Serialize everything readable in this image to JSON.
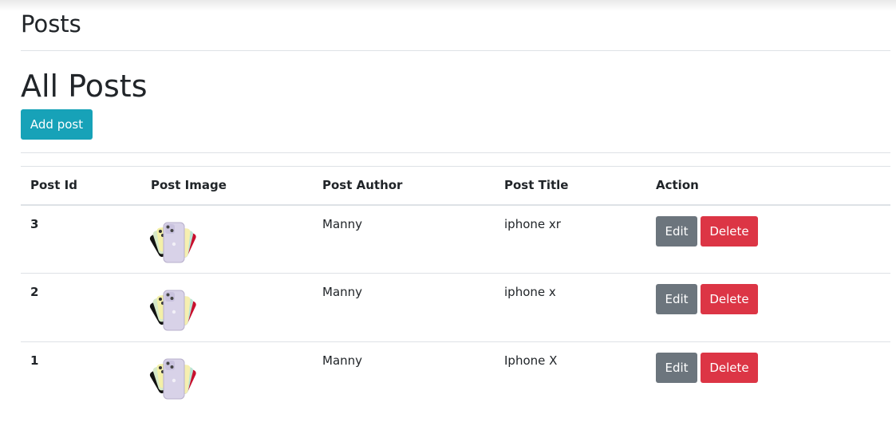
{
  "header": {
    "title": "Posts"
  },
  "main": {
    "title": "All Posts",
    "add_button_label": "Add post"
  },
  "table": {
    "columns": [
      "Post Id",
      "Post Image",
      "Post Author",
      "Post Title",
      "Action"
    ],
    "rows": [
      {
        "id": "3",
        "image_icon": "iphone-thumbnail-icon",
        "author": "Manny",
        "title": "iphone xr",
        "edit_label": "Edit",
        "delete_label": "Delete"
      },
      {
        "id": "2",
        "image_icon": "iphone-thumbnail-icon",
        "author": "Manny",
        "title": "iphone x",
        "edit_label": "Edit",
        "delete_label": "Delete"
      },
      {
        "id": "1",
        "image_icon": "iphone-thumbnail-icon",
        "author": "Manny",
        "title": "Iphone X",
        "edit_label": "Edit",
        "delete_label": "Delete"
      }
    ]
  },
  "colors": {
    "info": "#17a2b8",
    "secondary": "#6c757d",
    "danger": "#dc3545"
  }
}
